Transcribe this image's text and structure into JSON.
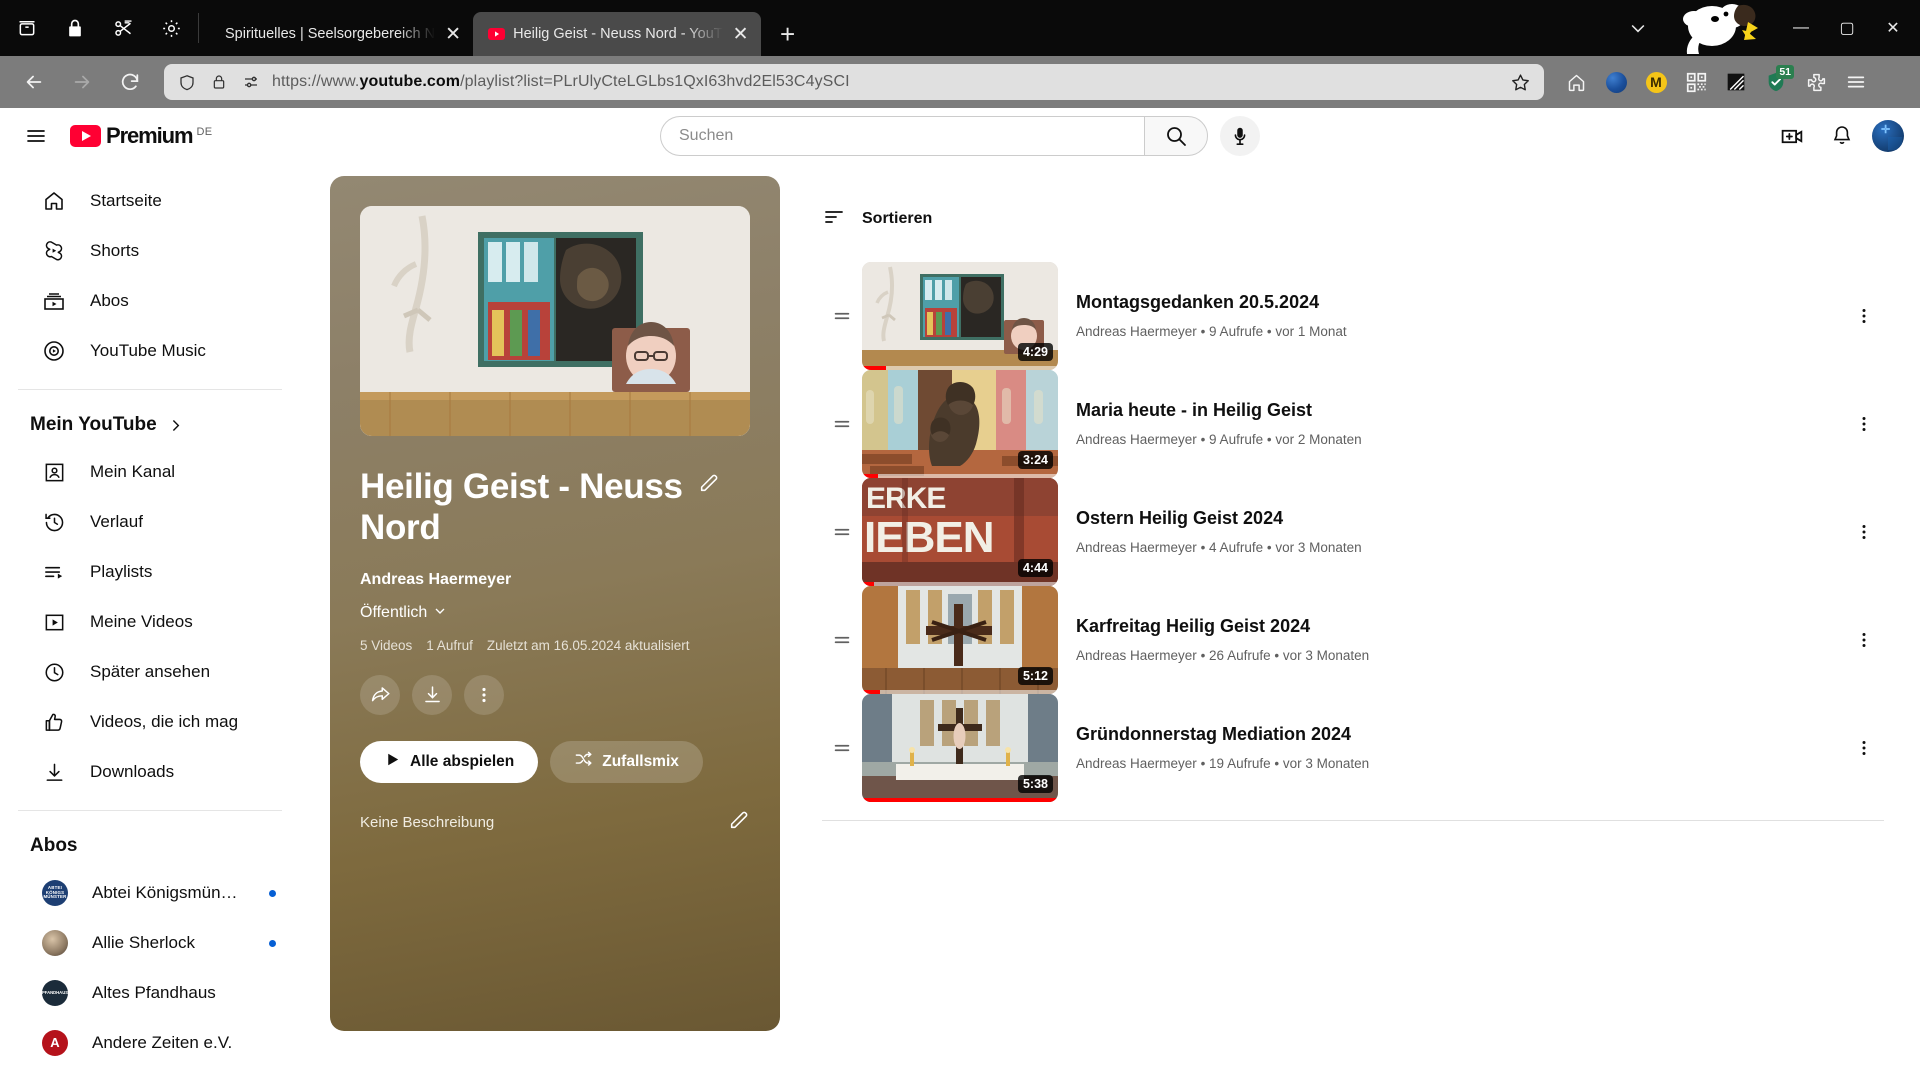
{
  "browser": {
    "window_tools": [
      "archive-icon",
      "lock-icon",
      "scissors-icon",
      "settings-icon"
    ],
    "tabs": [
      {
        "title": "Spirituelles | Seelsorgebereich N",
        "active": false,
        "favicon": "none"
      },
      {
        "title": "Heilig Geist - Neuss Nord - YouT",
        "active": true,
        "favicon": "youtube-icon"
      }
    ],
    "new_tab_label": "+",
    "url": "https://www.youtube.com/playlist?list=PLrUlyCteLGLbs1QxI63hvd2El53C4ySCI",
    "url_host": "youtube.com",
    "url_prefix": "https://www.",
    "url_suffix": "/playlist?list=PLrUlyCteLGLbs1QxI63hvd2El53C4ySCI",
    "shield_badge_count": "51",
    "toolbar_icons": [
      "home-icon",
      "globe-icon",
      "m-extension-icon",
      "qr-code-icon",
      "dark-reader-icon",
      "shield-icon",
      "extensions-icon",
      "menu-icon"
    ],
    "caption": {
      "minimize": "—",
      "maximize": "▢",
      "close": "✕"
    }
  },
  "youtube": {
    "logo": {
      "word": "Premium",
      "country": "DE"
    },
    "search": {
      "placeholder": "Suchen",
      "value": ""
    },
    "header_icons": [
      "create-video-icon",
      "notifications-icon",
      "avatar"
    ],
    "sidebar": {
      "primary": [
        {
          "label": "Startseite",
          "icon": "home-icon"
        },
        {
          "label": "Shorts",
          "icon": "shorts-icon"
        },
        {
          "label": "Abos",
          "icon": "subscriptions-icon"
        },
        {
          "label": "YouTube Music",
          "icon": "youtube-music-icon"
        }
      ],
      "you_heading": "Mein YouTube",
      "you_items": [
        {
          "label": "Mein Kanal",
          "icon": "channel-icon"
        },
        {
          "label": "Verlauf",
          "icon": "history-icon"
        },
        {
          "label": "Playlists",
          "icon": "playlists-icon"
        },
        {
          "label": "Meine Videos",
          "icon": "my-videos-icon"
        },
        {
          "label": "Später ansehen",
          "icon": "watch-later-icon"
        },
        {
          "label": "Videos, die ich mag",
          "icon": "liked-videos-icon"
        },
        {
          "label": "Downloads",
          "icon": "downloads-icon"
        }
      ],
      "subs_heading": "Abos",
      "subscriptions": [
        {
          "label": "Abtei Königsmün…",
          "new": true,
          "avatar_text": "ABTEI KÖNIGS MÜNSTER",
          "avatar_color": "#1d3f73"
        },
        {
          "label": "Allie Sherlock",
          "new": true,
          "avatar_text": "",
          "avatar_color": "#9a8c7d"
        },
        {
          "label": "Altes Pfandhaus",
          "new": false,
          "avatar_text": "PFANDHAUS",
          "avatar_color": "#1b2b3a"
        },
        {
          "label": "Andere Zeiten e.V.",
          "new": false,
          "avatar_text": "A",
          "avatar_color": "#b5121b"
        }
      ]
    },
    "playlist": {
      "title": "Heilig Geist - Neuss Nord",
      "channel": "Andreas Haermeyer",
      "privacy": "Öffentlich",
      "stats": [
        "5 Videos",
        "1 Aufruf",
        "Zuletzt am 16.05.2024 aktualisiert"
      ],
      "actions": [
        "share-icon",
        "download-icon",
        "more-icon"
      ],
      "play_all_label": "Alle abspielen",
      "shuffle_label": "Zufallsmix",
      "description": "Keine Beschreibung",
      "edit_title_icon": "pencil-icon",
      "edit_description_icon": "pencil-icon"
    },
    "sort_label": "Sortieren",
    "videos": [
      {
        "title": "Montagsgedanken 20.5.2024",
        "channel": "Andreas Haermeyer",
        "views": "9 Aufrufe",
        "age": "vor 1 Monat",
        "duration": "4:29",
        "progress_pct": 12
      },
      {
        "title": "Maria heute - in Heilig Geist",
        "channel": "Andreas Haermeyer",
        "views": "9 Aufrufe",
        "age": "vor 2 Monaten",
        "duration": "3:24",
        "progress_pct": 8
      },
      {
        "title": "Ostern Heilig Geist 2024",
        "channel": "Andreas Haermeyer",
        "views": "4 Aufrufe",
        "age": "vor 3 Monaten",
        "duration": "4:44",
        "progress_pct": 6
      },
      {
        "title": "Karfreitag Heilig Geist 2024",
        "channel": "Andreas Haermeyer",
        "views": "26 Aufrufe",
        "age": "vor 3 Monaten",
        "duration": "5:12",
        "progress_pct": 9
      },
      {
        "title": "Gründonnerstag Mediation 2024",
        "channel": "Andreas Haermeyer",
        "views": "19 Aufrufe",
        "age": "vor 3 Monaten",
        "duration": "5:38",
        "progress_pct": 100
      }
    ]
  },
  "colors": {
    "yt_red": "#ff0033",
    "accent_blue": "#065fd4",
    "playlist_gradient_top": "#938872",
    "playlist_gradient_bottom": "#6a5833",
    "shield_green": "#2b7f4f"
  }
}
